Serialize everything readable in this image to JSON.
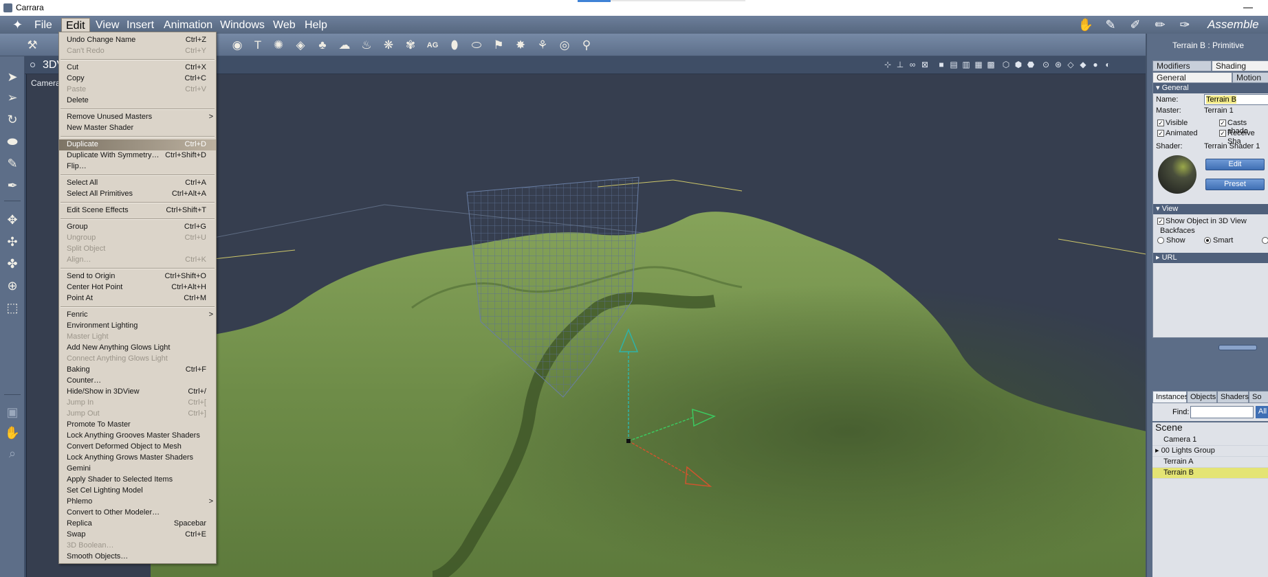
{
  "app": {
    "title": "Carrara",
    "room_label": "Assemble",
    "minimize": "—"
  },
  "menubar": [
    "File",
    "Edit",
    "View",
    "Insert",
    "Animation",
    "Windows",
    "Web",
    "Help"
  ],
  "viewport": {
    "title": "3DV",
    "camera_label": "Camera"
  },
  "edit_menu": [
    {
      "label": "Undo Change Name",
      "shortcut": "Ctrl+Z"
    },
    {
      "label": "Can't Redo",
      "shortcut": "Ctrl+Y",
      "disabled": true
    },
    {
      "sep": true
    },
    {
      "label": "Cut",
      "shortcut": "Ctrl+X"
    },
    {
      "label": "Copy",
      "shortcut": "Ctrl+C"
    },
    {
      "label": "Paste",
      "shortcut": "Ctrl+V",
      "disabled": true
    },
    {
      "label": "Delete",
      "shortcut": ""
    },
    {
      "sep": true
    },
    {
      "label": "Remove Unused Masters",
      "shortcut": "",
      "submenu": true
    },
    {
      "label": "New Master Shader",
      "shortcut": ""
    },
    {
      "sep": true
    },
    {
      "label": "Duplicate",
      "shortcut": "Ctrl+D",
      "highlight": true
    },
    {
      "label": "Duplicate With Symmetry…",
      "shortcut": "Ctrl+Shift+D"
    },
    {
      "label": "Flip…",
      "shortcut": ""
    },
    {
      "sep": true
    },
    {
      "label": "Select All",
      "shortcut": "Ctrl+A"
    },
    {
      "label": "Select All Primitives",
      "shortcut": "Ctrl+Alt+A"
    },
    {
      "sep": true
    },
    {
      "label": "Edit Scene Effects",
      "shortcut": "Ctrl+Shift+T"
    },
    {
      "sep": true
    },
    {
      "label": "Group",
      "shortcut": "Ctrl+G"
    },
    {
      "label": "Ungroup",
      "shortcut": "Ctrl+U",
      "disabled": true
    },
    {
      "label": "Split Object",
      "shortcut": "",
      "disabled": true
    },
    {
      "label": "Align…",
      "shortcut": "Ctrl+K",
      "disabled": true
    },
    {
      "sep": true
    },
    {
      "label": "Send to Origin",
      "shortcut": "Ctrl+Shift+O"
    },
    {
      "label": "Center Hot Point",
      "shortcut": "Ctrl+Alt+H"
    },
    {
      "label": "Point At",
      "shortcut": "Ctrl+M"
    },
    {
      "sep": true
    },
    {
      "label": "Fenric",
      "shortcut": "",
      "submenu": true
    },
    {
      "label": "Environment Lighting",
      "shortcut": ""
    },
    {
      "label": "Master Light",
      "shortcut": "",
      "disabled": true
    },
    {
      "label": "Add New Anything Glows Light",
      "shortcut": ""
    },
    {
      "label": "Connect Anything Glows Light",
      "shortcut": "",
      "disabled": true
    },
    {
      "label": "Baking",
      "shortcut": "Ctrl+F"
    },
    {
      "label": "Counter…",
      "shortcut": ""
    },
    {
      "label": "Hide/Show in 3DView",
      "shortcut": "Ctrl+/"
    },
    {
      "label": "Jump In",
      "shortcut": "Ctrl+[",
      "disabled": true
    },
    {
      "label": "Jump Out",
      "shortcut": "Ctrl+]",
      "disabled": true
    },
    {
      "label": "Promote To Master",
      "shortcut": ""
    },
    {
      "label": "Lock Anything Grooves Master Shaders",
      "shortcut": ""
    },
    {
      "label": "Convert Deformed Object to Mesh",
      "shortcut": ""
    },
    {
      "label": "Lock Anything Grows Master Shaders",
      "shortcut": ""
    },
    {
      "label": "Gemini",
      "shortcut": ""
    },
    {
      "label": "Apply Shader to Selected Items",
      "shortcut": ""
    },
    {
      "label": "Set Cel Lighting Model",
      "shortcut": ""
    },
    {
      "label": "Phlemo",
      "shortcut": "",
      "submenu": true
    },
    {
      "label": "Convert to Other Modeler…",
      "shortcut": ""
    },
    {
      "label": "Replica",
      "shortcut": "Spacebar"
    },
    {
      "label": "Swap",
      "shortcut": "Ctrl+E"
    },
    {
      "label": "3D Boolean…",
      "shortcut": "",
      "disabled": true
    },
    {
      "label": "Smooth Objects…",
      "shortcut": ""
    }
  ],
  "panel": {
    "header": "Terrain B : Primitive",
    "tabs_top": [
      "Modifiers",
      "Shading"
    ],
    "tabs_sub": [
      "General",
      "Motion"
    ],
    "general_section": "General",
    "name_label": "Name:",
    "name_value": "Terrain B",
    "master_label": "Master:",
    "master_value": "Terrain 1",
    "checks": [
      {
        "label": "Visible",
        "checked": true
      },
      {
        "label": "Casts shado",
        "checked": true
      },
      {
        "label": "Animated",
        "checked": true
      },
      {
        "label": "Receive Sha",
        "checked": true
      }
    ],
    "shader_label": "Shader:",
    "shader_value": "Terrain Shader 1",
    "edit_button": "Edit",
    "preset_button": "Preset",
    "view_section": "View",
    "show_in_3d": "Show Object in 3D View",
    "backfaces_label": "Backfaces",
    "backfaces_options": [
      "Show",
      "Smart"
    ],
    "url_section": "URL"
  },
  "browser": {
    "tabs": [
      "Instances",
      "Objects",
      "Shaders",
      "So"
    ],
    "find_label": "Find:",
    "find_value": "",
    "all_button": "All",
    "scene_title": "Scene",
    "items": [
      {
        "label": "Camera 1"
      },
      {
        "label": "00 Lights Group",
        "expandable": true
      },
      {
        "label": "Terrain A"
      },
      {
        "label": "Terrain B",
        "selected": true
      }
    ]
  }
}
